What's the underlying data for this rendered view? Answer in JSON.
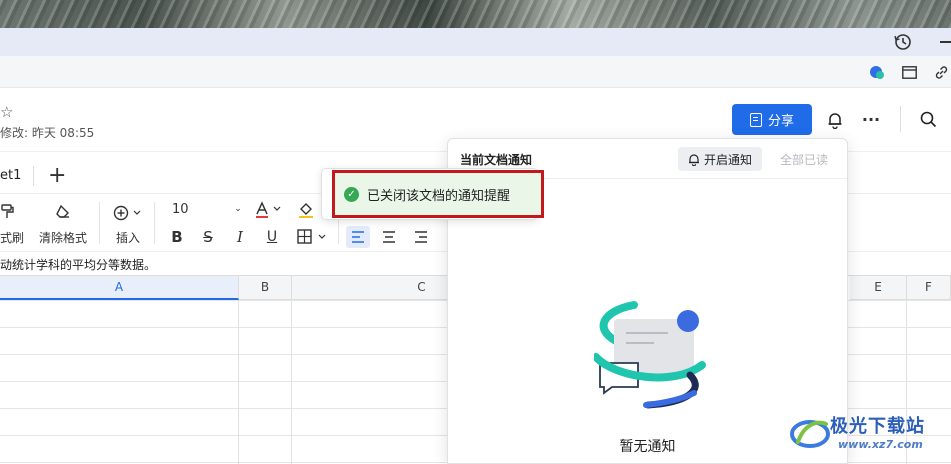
{
  "document": {
    "modified": "修改: 昨天 08:55",
    "share_label": "分享"
  },
  "sheets": {
    "current": "et1"
  },
  "toolbar": {
    "format_painter_label": "式刷",
    "clear_format_label": "清除格式",
    "insert_label": "插入",
    "font_size": "10"
  },
  "formula": {
    "text": "动统计学科的平均分等数据。"
  },
  "columns": [
    "A",
    "B",
    "C",
    "E",
    "F"
  ],
  "panel": {
    "title": "当前文档通知",
    "enable_label": "开启通知",
    "mark_read_label": "全部已读",
    "empty_text": "暂无通知"
  },
  "toast": {
    "message": "已关闭该文档的通知提醒"
  },
  "watermark": {
    "name": "极光下载站",
    "url": "www.xz7.com"
  },
  "colors": {
    "accent": "#1f6be8",
    "toast_border": "#c21a1a",
    "toast_bg": "#eaf7e8",
    "success": "#34a853"
  }
}
